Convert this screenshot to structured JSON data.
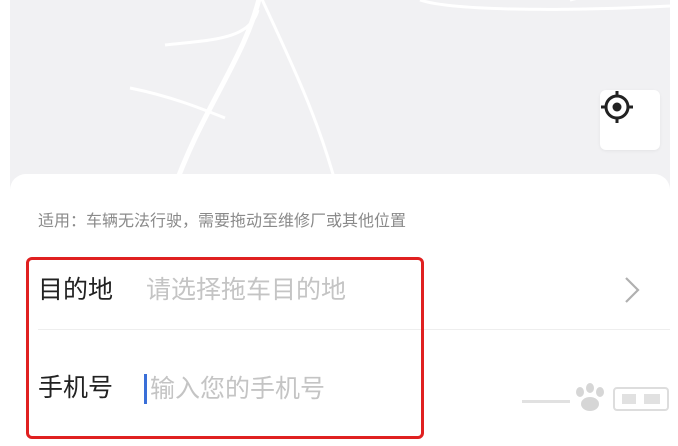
{
  "map": {
    "locate_icon": "locate-crosshair-icon"
  },
  "panel": {
    "note": "适用：车辆无法行驶，需要拖动至维修厂或其他位置",
    "destination": {
      "label": "目的地",
      "placeholder": "请选择拖车目的地",
      "chevron_icon": "chevron-right-icon"
    },
    "phone": {
      "label": "手机号",
      "placeholder": "输入您的手机号"
    }
  },
  "annotation": {
    "highlight_color": "#e02020"
  },
  "colors": {
    "caret": "#3a6fd8",
    "placeholder": "#c4c4c4",
    "label": "#222222"
  },
  "watermark": {
    "icon": "baidu-jingyan-logo"
  }
}
